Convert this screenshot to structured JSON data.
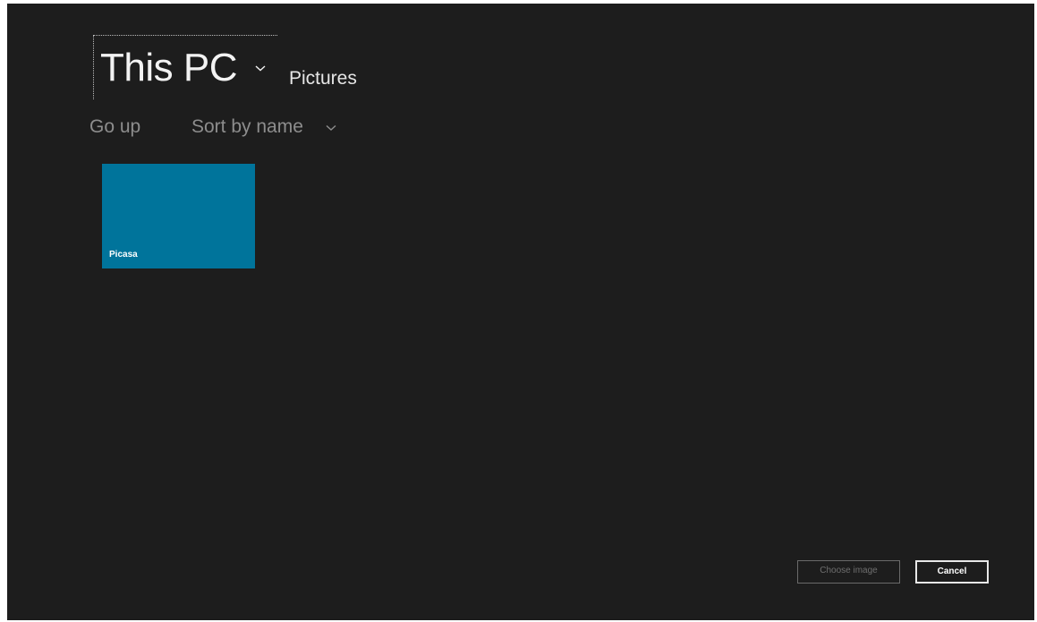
{
  "location": {
    "title": "This PC",
    "subfolder": "Pictures",
    "chevron_icon": "chevron-down-icon"
  },
  "toolbar": {
    "go_up_label": "Go up",
    "sort_label": "Sort by name",
    "sort_chevron_icon": "chevron-down-icon"
  },
  "folders": [
    {
      "name": "Picasa",
      "color": "#00749b"
    }
  ],
  "buttons": {
    "choose_label": "Choose image",
    "cancel_label": "Cancel"
  },
  "colors": {
    "background": "#1d1d1d",
    "tile_accent": "#00749b",
    "primary_text": "#f3f3f3",
    "dim_text": "#8d8d8d"
  }
}
